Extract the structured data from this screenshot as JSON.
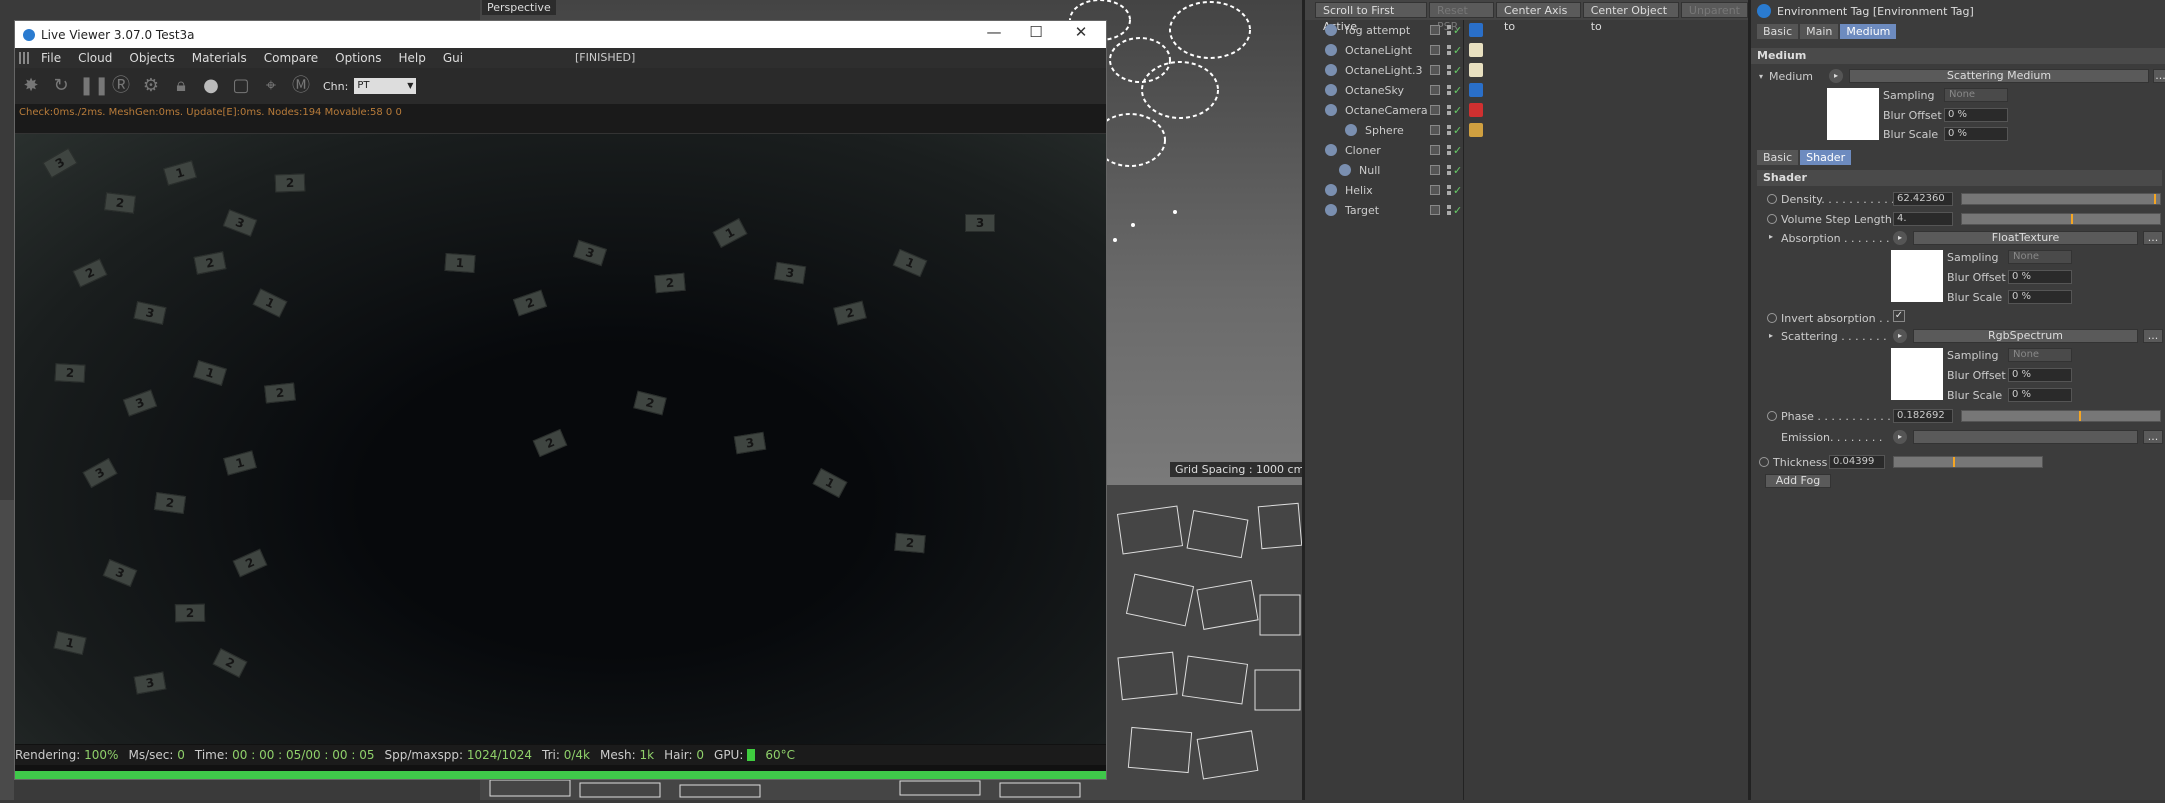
{
  "viewport": {
    "tab_label": "Perspective",
    "grid_spacing": "Grid Spacing : 1000 cm"
  },
  "live_viewer": {
    "title": "Live Viewer 3.07.0 Test3a",
    "status_tag": "[FINISHED]",
    "window_controls": {
      "minimize": "—",
      "maximize": "☐",
      "close": "✕"
    },
    "menu": [
      "File",
      "Cloud",
      "Objects",
      "Materials",
      "Compare",
      "Options",
      "Help",
      "Gui"
    ],
    "toolbar_icons": [
      "render-icon",
      "refresh-icon",
      "pause-icon",
      "region-icon",
      "settings-icon",
      "lock-icon",
      "sphere-icon",
      "focus-icon",
      "pick-icon",
      "material-pick-icon"
    ],
    "channel_label": "Chn:",
    "channel_value": "PT",
    "info_line": "Check:0ms./2ms. MeshGen:0ms. Update[E]:0ms. Nodes:194 Movable:58  0 0",
    "status": {
      "rendering_label": "Rendering:",
      "rendering_value": "100%",
      "ms_label": "Ms/sec:",
      "ms_value": "0",
      "time_label": "Time:",
      "time_value": "00 : 00 : 05/00 : 00 : 05",
      "spp_label": "Spp/maxspp:",
      "spp_value": "1024/1024",
      "tri_label": "Tri:",
      "tri_value": "0/4k",
      "mesh_label": "Mesh:",
      "mesh_value": "1k",
      "hair_label": "Hair:",
      "hair_value": "0",
      "gpu_label": "GPU:",
      "gpu_temp": "60°C"
    },
    "progress": 1.0,
    "cards": [
      "3",
      "2",
      "1",
      "3",
      "2",
      "2",
      "3",
      "2",
      "1",
      "2",
      "3",
      "1",
      "2",
      "3",
      "2",
      "1",
      "3",
      "2",
      "2",
      "1",
      "3",
      "2",
      "1",
      "2",
      "3",
      "2",
      "1",
      "3",
      "2",
      "1",
      "3",
      "2",
      "2",
      "3",
      "1",
      "2"
    ]
  },
  "object_manager": {
    "buttons": [
      {
        "label": "Scroll to First Active",
        "enabled": true
      },
      {
        "label": "Reset PSR",
        "enabled": false
      },
      {
        "label": "Center Axis to",
        "enabled": true
      },
      {
        "label": "Center Object to",
        "enabled": true
      },
      {
        "label": "Unparent",
        "enabled": false
      }
    ],
    "objects": [
      {
        "name": "fog attempt",
        "icon": "environment-icon",
        "tag_color": "#2a6fc9"
      },
      {
        "name": "OctaneLight",
        "icon": "light-icon",
        "tag_color": "#e8e0c0"
      },
      {
        "name": "OctaneLight.3",
        "icon": "light-icon",
        "tag_color": "#e8e0c0"
      },
      {
        "name": "OctaneSky",
        "icon": "sky-icon",
        "tag_color": "#2a6fc9"
      },
      {
        "name": "OctaneCamera",
        "icon": "camera-icon",
        "tag_color": "#d03030"
      },
      {
        "name": "Sphere",
        "icon": "sphere-icon",
        "tag_color": "#d0a040"
      },
      {
        "name": "Cloner",
        "icon": "cloner-icon",
        "tag_color": ""
      },
      {
        "name": "Null",
        "icon": "null-icon",
        "tag_color": ""
      },
      {
        "name": "Helix",
        "icon": "helix-icon",
        "tag_color": ""
      },
      {
        "name": "Target",
        "icon": "target-icon",
        "tag_color": ""
      }
    ]
  },
  "attributes": {
    "header": "Environment Tag [Environment Tag]",
    "tabs_top": [
      "Basic",
      "Main",
      "Medium"
    ],
    "active_top": "Medium",
    "section_medium": "Medium",
    "medium_label": "Medium",
    "medium_value": "Scattering Medium",
    "sampling_label": "Sampling",
    "sampling_value": "None",
    "blur_offset_label": "Blur Offset",
    "blur_offset_value": "0 %",
    "blur_scale_label": "Blur Scale",
    "blur_scale_value": "0 %",
    "tabs_shader": [
      "Basic",
      "Shader"
    ],
    "active_shader": "Shader",
    "section_shader": "Shader",
    "density_label": "Density. . . . . . . . . . .",
    "density_value": "62.42360",
    "density_fraction": 0.97,
    "volume_step_label": "Volume Step Length",
    "volume_step_value": "4.",
    "volume_step_fraction": 0.55,
    "absorption_label": "Absorption . . . . . . .",
    "absorption_value": "FloatTexture",
    "invert_absorption_label": "Invert absorption . .",
    "invert_absorption_checked": "✓",
    "scattering_label": "Scattering . . . . . . .",
    "scattering_value": "RgbSpectrum",
    "phase_label": "Phase . . . . . . . . . . .",
    "phase_value": "0.182692",
    "phase_fraction": 0.59,
    "emission_label": "Emission. . . . . . . .",
    "thickness_label": "Thickness",
    "thickness_value": "0.04399",
    "thickness_fraction": 0.4,
    "add_fog": "Add Fog",
    "more": "..."
  }
}
